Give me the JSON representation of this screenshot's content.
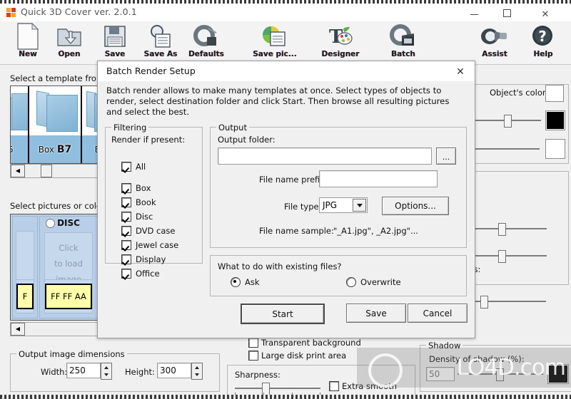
{
  "window": {
    "title": "Quick 3D Cover ver. 2.0.1",
    "minimize": "—",
    "maximize": "□",
    "close": "✕"
  },
  "toolbar": {
    "items": [
      {
        "label": "New",
        "icon": "new-document-icon"
      },
      {
        "label": "Open",
        "icon": "open-folder-icon"
      },
      {
        "label": "Save",
        "icon": "floppy-disk-icon"
      },
      {
        "label": "Save As",
        "icon": "save-as-magnifier-icon"
      },
      {
        "label": "Defaults",
        "icon": "defaults-icon"
      },
      {
        "label": "Save pic...",
        "icon": "save-picture-icon"
      },
      {
        "label": "Designer",
        "icon": "designer-palette-icon"
      },
      {
        "label": "Batch",
        "icon": "batch-clapper-icon"
      },
      {
        "label": "Assist",
        "icon": "assist-flashlight-icon"
      },
      {
        "label": "Help",
        "icon": "help-question-icon"
      }
    ]
  },
  "background": {
    "template_label": "Select a template from the",
    "templates": [
      {
        "name": "5",
        "bold": ""
      },
      {
        "name": "Box",
        "bold": "B7"
      },
      {
        "name": "Box",
        "bold": "B"
      }
    ],
    "pictures_label": "Select pictures or colors fo",
    "disc_title": "DISC",
    "disc_placeholder": "Click\nto load\nimage",
    "disc_click": "Click",
    "disc_to_load": "to load",
    "disc_image": "image",
    "color_code": "FF FF AA",
    "color_hex": "#FFFFAA",
    "partial_swatch_text": "F",
    "objects_color_label": "Object's color:",
    "percent_label_1": "):",
    "percent_label_2": "%):",
    "percent_label_3": ":",
    "percent_label_4": "(%):",
    "percent_label_5": "ions:",
    "dimensions_group": "Output image dimensions",
    "width_label": "Width:",
    "width_value": "250",
    "height_label": "Height:",
    "height_value": "300",
    "transparent_background": "Transparent background",
    "large_disk_print_area": "Large disk print area",
    "sharpness_label": "Sharpness:",
    "extra_smooth": "Extra smooth",
    "shadow_group": "Shadow",
    "density_label": "Density of shadow (%):",
    "density_value": "50",
    "black_color": "#000000",
    "white_color": "#FFFFFF"
  },
  "dialog": {
    "title": "Batch Render Setup",
    "close_icon": "✕",
    "description": "Batch render allows to make many templates at once. Select types of objects to render, select destination folder and click Start. Then browse all resulting pictures and select the best.",
    "filtering": {
      "group_title": "Filtering",
      "subtitle": "Render if present:",
      "options": [
        {
          "label": "All",
          "checked": true
        },
        {
          "label": "Box",
          "checked": true
        },
        {
          "label": "Book",
          "checked": true
        },
        {
          "label": "Disc",
          "checked": true
        },
        {
          "label": "DVD case",
          "checked": true
        },
        {
          "label": "Jewel case",
          "checked": true
        },
        {
          "label": "Display",
          "checked": true
        },
        {
          "label": "Office",
          "checked": true
        }
      ]
    },
    "output": {
      "group_title": "Output",
      "folder_label": "Output folder:",
      "folder_value": "",
      "folder_placeholder": "",
      "browse_label": "...",
      "prefix_label": "File name prefix:",
      "prefix_value": "",
      "prefix_placeholder": "",
      "filetype_label": "File type:",
      "filetype_value": "JPG",
      "filetype_options": [
        "JPG"
      ],
      "options_label": "Options...",
      "sample_label": "File name sample:",
      "sample_value": "\"_A1.jpg\", _A2.jpg\"..."
    },
    "existing": {
      "question": "What to do with existing files?",
      "choices": [
        {
          "label": "Ask",
          "selected": true
        },
        {
          "label": "Overwrite",
          "selected": false
        }
      ]
    },
    "buttons": {
      "start": "Start",
      "save": "Save",
      "cancel": "Cancel"
    }
  },
  "watermark": {
    "text": "LO4D.com"
  }
}
